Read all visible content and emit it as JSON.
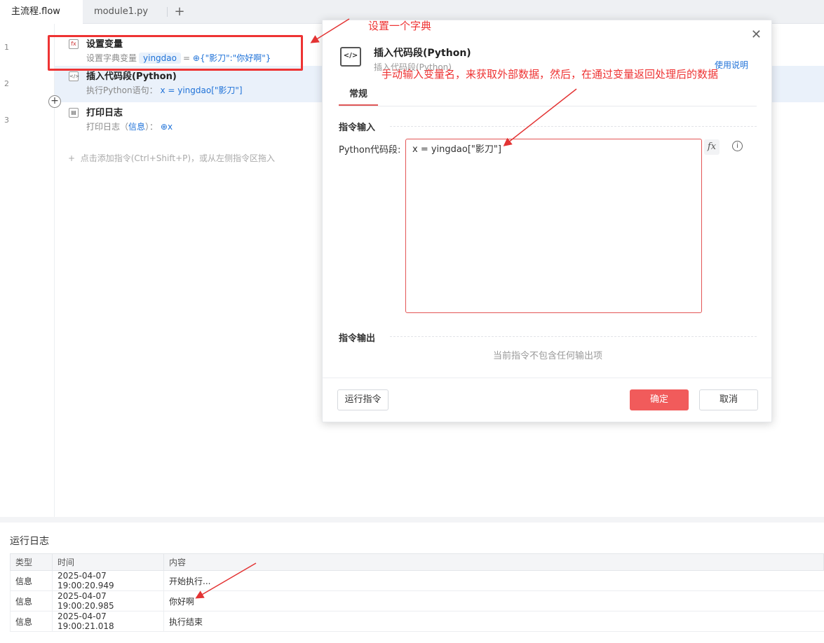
{
  "tabs": [
    {
      "label": "主流程.flow",
      "active": true
    },
    {
      "label": "module1.py",
      "active": false
    }
  ],
  "add_tab_icon": "plus-icon",
  "editor": {
    "lines": [
      "1",
      "2",
      "3"
    ],
    "steps": [
      {
        "title": "设置变量",
        "desc_prefix": "设置字典变量",
        "var_name": "yingdao",
        "equals": "=",
        "value": "{\"影刀\":\"你好啊\"}",
        "icon": "variable-icon"
      },
      {
        "title": "插入代码段(Python)",
        "desc_prefix": "执行Python语句：",
        "value": "x = yingdao[\"影刀\"]",
        "icon": "code-icon"
      },
      {
        "title": "打印日志",
        "desc_prefix": "打印日志（",
        "level": "信息",
        "desc_mid": "）：",
        "value": "x",
        "icon": "printer-icon"
      }
    ],
    "add_hint": "点击添加指令(Ctrl+Shift+P)，或从左侧指令区拖入"
  },
  "dialog": {
    "title": "插入代码段(Python)",
    "subtitle": "插入代码段(Python)",
    "help_link": "使用说明",
    "tab": "常规",
    "input_section": "指令输入",
    "field_label": "Python代码段:",
    "code_value": "x = yingdao[\"影刀\"]",
    "fx_label": "fx",
    "output_section": "指令输出",
    "no_output": "当前指令不包含任何输出项",
    "run_button": "运行指令",
    "ok_button": "确定",
    "cancel_button": "取消",
    "close_icon": "close-icon"
  },
  "log": {
    "title": "运行日志",
    "columns": [
      "类型",
      "时间",
      "内容"
    ],
    "rows": [
      {
        "type": "信息",
        "time": "2025-04-07 19:00:20.949",
        "content": "开始执行..."
      },
      {
        "type": "信息",
        "time": "2025-04-07 19:00:20.985",
        "content": "你好啊"
      },
      {
        "type": "信息",
        "time": "2025-04-07 19:00:21.018",
        "content": "执行结束"
      }
    ]
  },
  "annotations": {
    "dict_note": "设置一个字典",
    "code_note": "手动输入变量名，来获取外部数据，然后，在通过变量返回处理后的数据",
    "color": "#e33333"
  }
}
